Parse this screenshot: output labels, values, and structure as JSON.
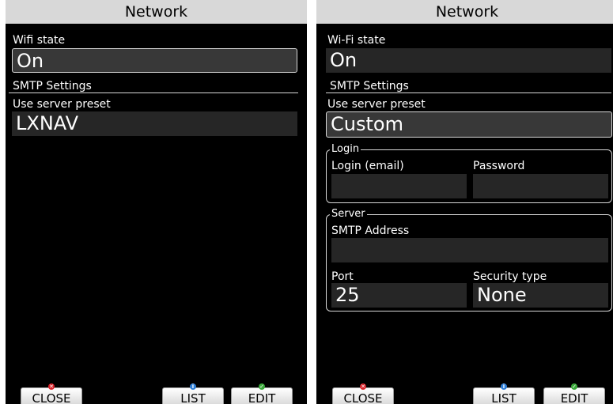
{
  "left": {
    "title": "Network",
    "wifi_label": "Wifi state",
    "wifi_value": "On",
    "smtp_section": "SMTP Settings",
    "preset_label": "Use server preset",
    "preset_value": "LXNAV",
    "buttons": {
      "close": "CLOSE",
      "list": "LIST",
      "edit": "EDIT"
    }
  },
  "right": {
    "title": "Network",
    "wifi_label": "Wi-Fi state",
    "wifi_value": "On",
    "smtp_section": "SMTP Settings",
    "preset_label": "Use server preset",
    "preset_value": "Custom",
    "login": {
      "legend": "Login",
      "email_label": "Login (email)",
      "email_value": "",
      "password_label": "Password",
      "password_value": ""
    },
    "server": {
      "legend": "Server",
      "address_label": "SMTP Address",
      "address_value": "",
      "port_label": "Port",
      "port_value": "25",
      "security_label": "Security type",
      "security_value": "None"
    },
    "buttons": {
      "close": "CLOSE",
      "list": "LIST",
      "edit": "EDIT"
    }
  },
  "colors": {
    "close_dot": "#d9242b",
    "list_dot": "#2f7fd8",
    "edit_dot": "#3aa83a",
    "titlebar": "#d8d8d8"
  },
  "icons": {
    "close": "x-icon",
    "list": "info-icon",
    "edit": "check-icon"
  }
}
